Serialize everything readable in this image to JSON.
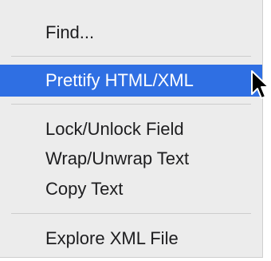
{
  "menu": {
    "items": [
      {
        "label": "Find..."
      },
      {
        "label": "Prettify HTML/XML"
      },
      {
        "label": "Lock/Unlock Field"
      },
      {
        "label": "Wrap/Unwrap Text"
      },
      {
        "label": "Copy Text"
      },
      {
        "label": "Explore XML File"
      }
    ],
    "highlighted_item": "Prettify HTML/XML",
    "highlight_color": "#2f6fe3",
    "cursor_icon": "arrow-cursor-icon"
  }
}
